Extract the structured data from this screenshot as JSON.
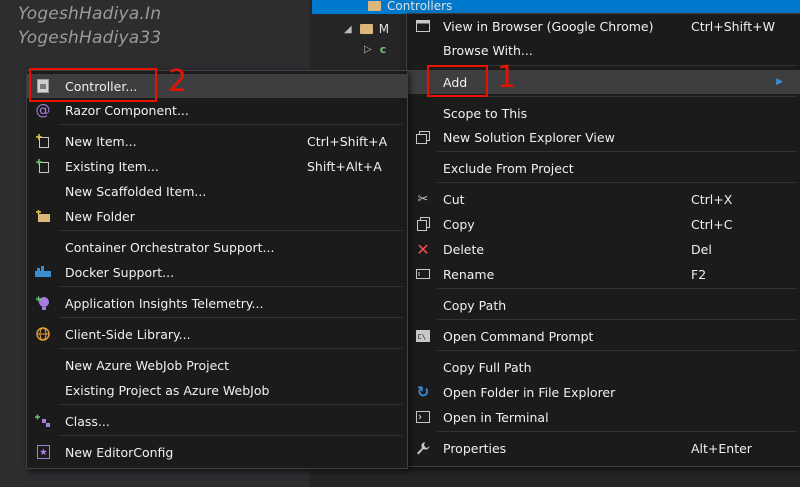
{
  "watermark": {
    "line1": "YogeshHadiya.In",
    "line2": "YogeshHadiya33"
  },
  "tree": {
    "selected_folder": "Controllers",
    "row2": "M",
    "row3": "c"
  },
  "annotations": {
    "one": "1",
    "two": "2"
  },
  "context_menu": {
    "items": [
      {
        "label": "View in Browser (Google Chrome)",
        "shortcut": "Ctrl+Shift+W",
        "icon": "browser-icon"
      },
      {
        "label": "Browse With...",
        "shortcut": ""
      },
      {
        "label": "Add",
        "shortcut": "",
        "icon": "submenu-arrow-icon"
      },
      {
        "label": "Scope to This",
        "shortcut": ""
      },
      {
        "label": "New Solution Explorer View",
        "shortcut": "",
        "icon": "new-view-icon"
      },
      {
        "label": "Exclude From Project",
        "shortcut": ""
      },
      {
        "label": "Cut",
        "shortcut": "Ctrl+X",
        "icon": "scissors-icon"
      },
      {
        "label": "Copy",
        "shortcut": "Ctrl+C",
        "icon": "copy-icon"
      },
      {
        "label": "Delete",
        "shortcut": "Del",
        "icon": "delete-x-icon"
      },
      {
        "label": "Rename",
        "shortcut": "F2",
        "icon": "rename-icon"
      },
      {
        "label": "Copy Path",
        "shortcut": ""
      },
      {
        "label": "Open Command Prompt",
        "shortcut": "",
        "icon": "command-prompt-icon"
      },
      {
        "label": "Copy Full Path",
        "shortcut": ""
      },
      {
        "label": "Open Folder in File Explorer",
        "shortcut": "",
        "icon": "refresh-arrow-icon"
      },
      {
        "label": "Open in Terminal",
        "shortcut": "",
        "icon": "terminal-icon"
      },
      {
        "label": "Properties",
        "shortcut": "Alt+Enter",
        "icon": "wrench-icon"
      }
    ]
  },
  "add_submenu": {
    "items": [
      {
        "label": "Controller...",
        "shortcut": "",
        "icon": "controller-icon"
      },
      {
        "label": "Razor Component...",
        "shortcut": "",
        "icon": "razor-icon"
      },
      {
        "label": "New Item...",
        "shortcut": "Ctrl+Shift+A",
        "icon": "new-item-icon"
      },
      {
        "label": "Existing Item...",
        "shortcut": "Shift+Alt+A",
        "icon": "existing-item-icon"
      },
      {
        "label": "New Scaffolded Item...",
        "shortcut": ""
      },
      {
        "label": "New Folder",
        "shortcut": "",
        "icon": "new-folder-icon"
      },
      {
        "label": "Container Orchestrator Support...",
        "shortcut": ""
      },
      {
        "label": "Docker Support...",
        "shortcut": "",
        "icon": "docker-icon"
      },
      {
        "label": "Application Insights Telemetry...",
        "shortcut": "",
        "icon": "insights-icon"
      },
      {
        "label": "Client-Side Library...",
        "shortcut": "",
        "icon": "library-icon"
      },
      {
        "label": "New Azure WebJob Project",
        "shortcut": ""
      },
      {
        "label": "Existing Project as Azure WebJob",
        "shortcut": ""
      },
      {
        "label": "Class...",
        "shortcut": "",
        "icon": "class-icon"
      },
      {
        "label": "New EditorConfig",
        "shortcut": "",
        "icon": "editorconfig-icon"
      }
    ]
  }
}
